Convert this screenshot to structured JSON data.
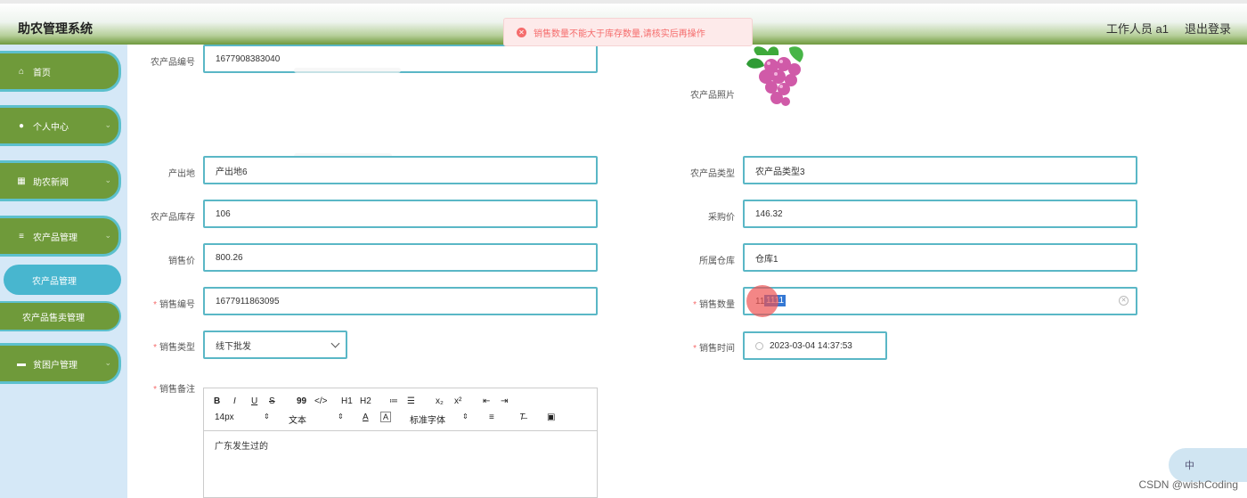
{
  "header": {
    "brand": "助农管理系统",
    "user": "工作人员 a1",
    "logout": "退出登录"
  },
  "toast": {
    "message": "销售数量不能大于库存数量,请核实后再操作"
  },
  "sidebar": {
    "items": [
      {
        "label": "首页",
        "icon": "home-icon"
      },
      {
        "label": "个人中心",
        "icon": "user-icon"
      },
      {
        "label": "助农新闻",
        "icon": "grid-icon"
      },
      {
        "label": "农产品管理",
        "icon": "list-icon"
      },
      {
        "label": "贫困户管理",
        "icon": "monitor-icon"
      }
    ],
    "sub": [
      {
        "label": "农产品管理"
      },
      {
        "label": "农产品售卖管理"
      }
    ]
  },
  "form": {
    "product_code": {
      "label": "农产品编号",
      "value": "1677908383040"
    },
    "photo": {
      "label": "农产品照片"
    },
    "origin": {
      "label": "产出地",
      "value": "产出地6"
    },
    "category": {
      "label": "农产品类型",
      "value": "农产品类型3"
    },
    "stock": {
      "label": "农产品库存",
      "value": "106"
    },
    "purchase_price": {
      "label": "采购价",
      "value": "146.32"
    },
    "sale_price": {
      "label": "销售价",
      "value": "800.26"
    },
    "warehouse": {
      "label": "所属仓库",
      "value": "仓库1"
    },
    "sale_code": {
      "label": "销售编号",
      "value": "1677911863095"
    },
    "sale_qty": {
      "label": "销售数量",
      "value_plain": "11",
      "value_selected": "1111"
    },
    "sale_type": {
      "label": "销售类型",
      "value": "线下批发"
    },
    "sale_time": {
      "label": "销售时间",
      "value": "2023-03-04 14:37:53"
    },
    "remarks": {
      "label": "销售备注",
      "content": "广东发生过的"
    }
  },
  "editor": {
    "row1": [
      "B",
      "I",
      "U",
      "S",
      "99",
      "</>",
      "H1",
      "H2",
      "≔",
      "☰",
      "x₂",
      "x²",
      "⇤",
      "⇥"
    ],
    "font_size": "14px",
    "text_style": "文本",
    "font_family": "标准字体"
  },
  "ime": {
    "label": "中"
  },
  "watermark": "CSDN @wishCoding"
}
